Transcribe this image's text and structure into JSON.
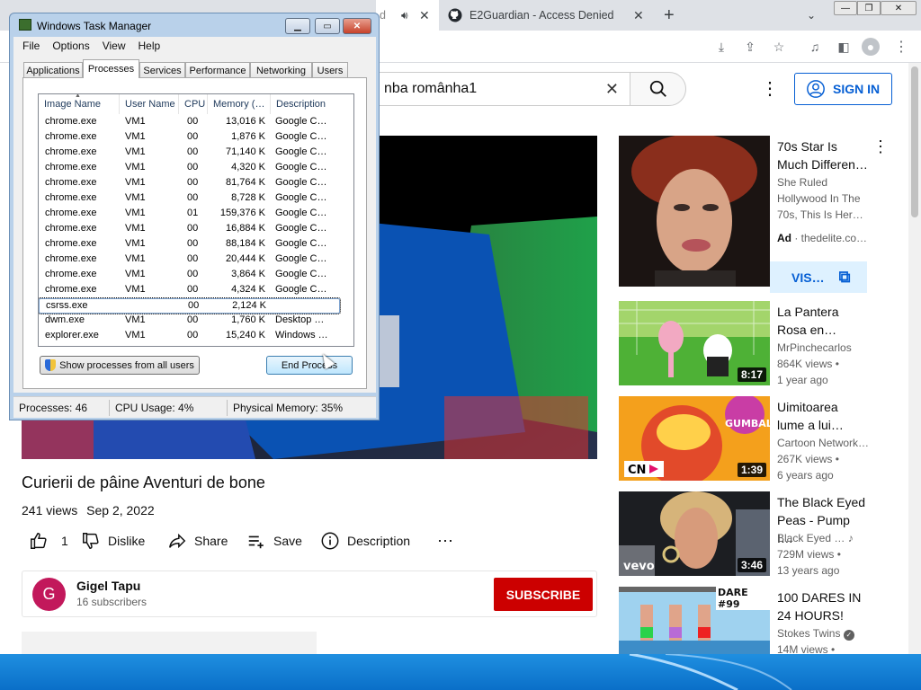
{
  "browser": {
    "tabs": [
      {
        "label": "d",
        "has_audio_icon": true
      },
      {
        "label": "E2Guardian - Access Denied"
      }
    ],
    "new_tab_label": "+"
  },
  "youtube": {
    "search_value": "nba românha1",
    "sign_in_label": "SIGN IN",
    "video": {
      "title": "Curierii de pâine Aventuri de bone",
      "views": "241 views",
      "date": "Sep 2, 2022",
      "likes": "1",
      "dislike_label": "Dislike",
      "share_label": "Share",
      "save_label": "Save",
      "description_label": "Description"
    },
    "channel": {
      "initial": "G",
      "name": "Gigel Tapu",
      "subscribers": "16 subscribers",
      "subscribe_label": "SUBSCRIBE"
    },
    "recommendations": [
      {
        "title_l1": "70s Star Is",
        "title_l2": "Much Differen…",
        "line1": "She Ruled",
        "line2": "Hollywood In The",
        "line3": "70s, This Is Her…",
        "ad_label": "Ad",
        "ad_domain": "thedelite.co…",
        "visit_label": "VIS…"
      },
      {
        "title_l1": "La Pantera",
        "title_l2": "Rosa en…",
        "channel": "MrPinchecarlos",
        "views": "864K views",
        "age": "1 year ago",
        "duration": "8:17"
      },
      {
        "title_l1": "Uimitoarea",
        "title_l2": "lume a lui…",
        "channel": "Cartoon Network…",
        "views": "267K views",
        "age": "6 years ago",
        "duration": "1:39"
      },
      {
        "title_l1": "The Black Eyed",
        "title_l2": "Peas - Pump I…",
        "channel": "Black Eyed …",
        "views": "729M views",
        "age": "13 years ago",
        "duration": "3:46",
        "thumb_logo": "vevo"
      },
      {
        "title_l1": "100 DARES IN",
        "title_l2": "24 HOURS!",
        "channel": "Stokes Twins",
        "views": "14M views",
        "thumb_text": "DARE #99"
      }
    ]
  },
  "taskmgr": {
    "title": "Windows Task Manager",
    "menu": [
      "File",
      "Options",
      "View",
      "Help"
    ],
    "tabs": [
      "Applications",
      "Processes",
      "Services",
      "Performance",
      "Networking",
      "Users"
    ],
    "columns": [
      "Image Name",
      "User Name",
      "CPU",
      "Memory (…",
      "Description"
    ],
    "rows": [
      [
        "chrome.exe",
        "VM1",
        "00",
        "13,016 K",
        "Google C…"
      ],
      [
        "chrome.exe",
        "VM1",
        "00",
        "1,876 K",
        "Google C…"
      ],
      [
        "chrome.exe",
        "VM1",
        "00",
        "71,140 K",
        "Google C…"
      ],
      [
        "chrome.exe",
        "VM1",
        "00",
        "4,320 K",
        "Google C…"
      ],
      [
        "chrome.exe",
        "VM1",
        "00",
        "81,764 K",
        "Google C…"
      ],
      [
        "chrome.exe",
        "VM1",
        "00",
        "8,728 K",
        "Google C…"
      ],
      [
        "chrome.exe",
        "VM1",
        "01",
        "159,376 K",
        "Google C…"
      ],
      [
        "chrome.exe",
        "VM1",
        "00",
        "16,884 K",
        "Google C…"
      ],
      [
        "chrome.exe",
        "VM1",
        "00",
        "88,184 K",
        "Google C…"
      ],
      [
        "chrome.exe",
        "VM1",
        "00",
        "20,444 K",
        "Google C…"
      ],
      [
        "chrome.exe",
        "VM1",
        "00",
        "3,864 K",
        "Google C…"
      ],
      [
        "chrome.exe",
        "VM1",
        "00",
        "4,324 K",
        "Google C…"
      ],
      [
        "csrss.exe",
        "",
        "00",
        "2,124 K",
        ""
      ],
      [
        "dwm.exe",
        "VM1",
        "00",
        "1,760 K",
        "Desktop …"
      ],
      [
        "explorer.exe",
        "VM1",
        "00",
        "15,240 K",
        "Windows …"
      ]
    ],
    "show_all_label": "Show processes from all users",
    "end_process_label": "End Process",
    "status": {
      "processes": "Processes: 46",
      "cpu": "CPU Usage: 4%",
      "memory": "Physical Memory: 35%"
    }
  },
  "colors": {
    "youtube_red": "#cc0000",
    "link_blue": "#065fd4",
    "taskbar_blue": "#0a6fc8"
  }
}
